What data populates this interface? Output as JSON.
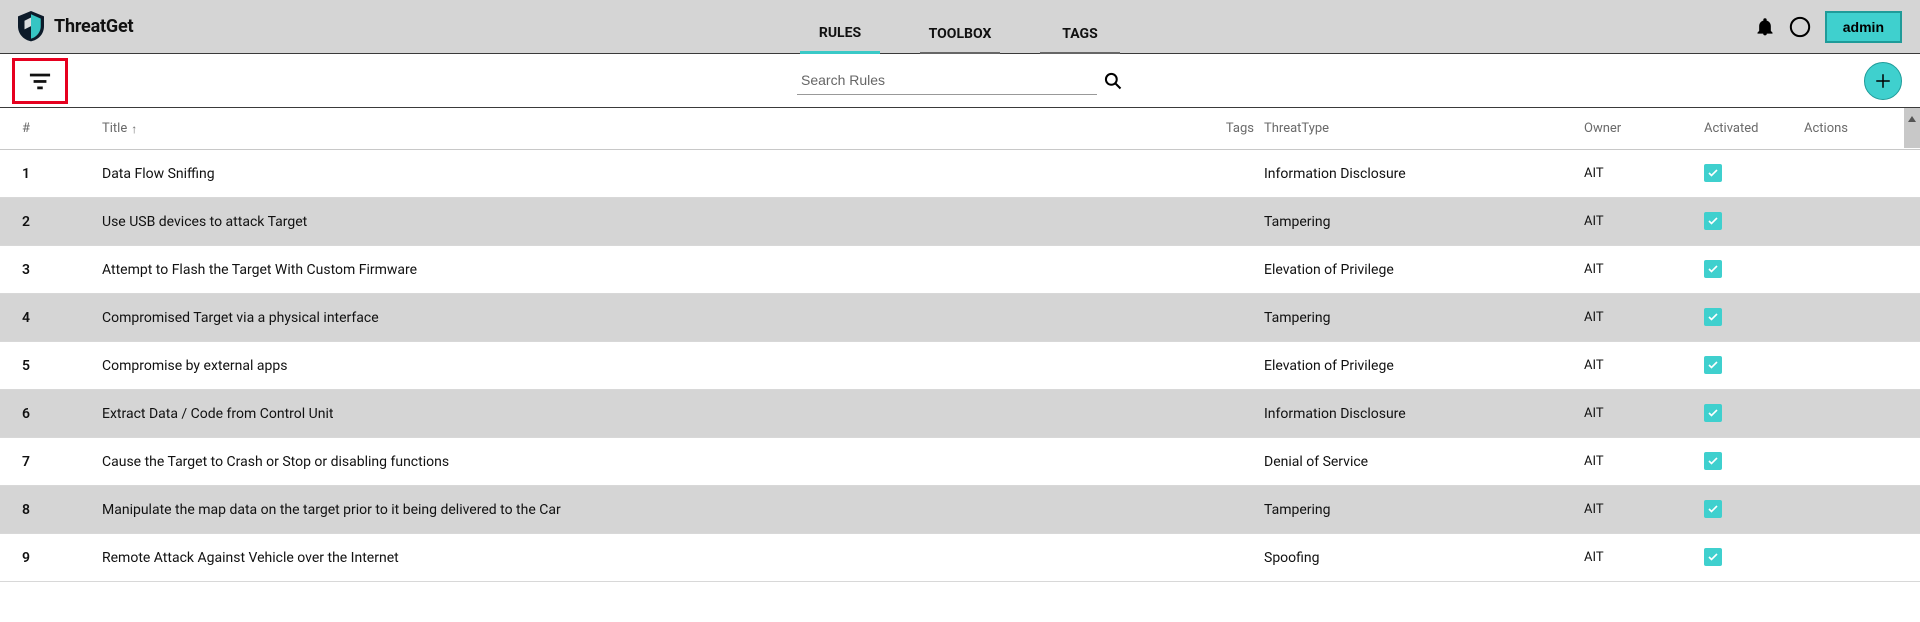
{
  "brand": {
    "name": "ThreatGet"
  },
  "tabs": [
    {
      "label": "RULES",
      "active": true
    },
    {
      "label": "TOOLBOX",
      "active": false
    },
    {
      "label": "TAGS",
      "active": false
    }
  ],
  "user": {
    "label": "admin"
  },
  "search": {
    "placeholder": "Search Rules"
  },
  "columns": {
    "num": "#",
    "title": "Title",
    "tags": "Tags",
    "threat": "ThreatType",
    "owner": "Owner",
    "activated": "Activated",
    "actions": "Actions"
  },
  "sort": {
    "column": "title",
    "dir": "asc",
    "glyph": "↑"
  },
  "rows": [
    {
      "n": "1",
      "title": "Data Flow Sniffing",
      "threat": "Information Disclosure",
      "owner": "AIT",
      "activated": true
    },
    {
      "n": "2",
      "title": "Use USB devices to attack Target",
      "threat": "Tampering",
      "owner": "AIT",
      "activated": true
    },
    {
      "n": "3",
      "title": "Attempt to Flash the Target With Custom Firmware",
      "threat": "Elevation of Privilege",
      "owner": "AIT",
      "activated": true
    },
    {
      "n": "4",
      "title": "Compromised Target via a physical interface",
      "threat": "Tampering",
      "owner": "AIT",
      "activated": true
    },
    {
      "n": "5",
      "title": "Compromise by external apps",
      "threat": "Elevation of Privilege",
      "owner": "AIT",
      "activated": true
    },
    {
      "n": "6",
      "title": "Extract Data / Code from Control Unit",
      "threat": "Information Disclosure",
      "owner": "AIT",
      "activated": true
    },
    {
      "n": "7",
      "title": "Cause the Target to Crash or Stop or disabling functions",
      "threat": "Denial of Service",
      "owner": "AIT",
      "activated": true
    },
    {
      "n": "8",
      "title": "Manipulate the map data on the target prior to it being delivered to the Car",
      "threat": "Tampering",
      "owner": "AIT",
      "activated": true
    },
    {
      "n": "9",
      "title": "Remote Attack Against Vehicle over the Internet",
      "threat": "Spoofing",
      "owner": "AIT",
      "activated": true
    }
  ]
}
